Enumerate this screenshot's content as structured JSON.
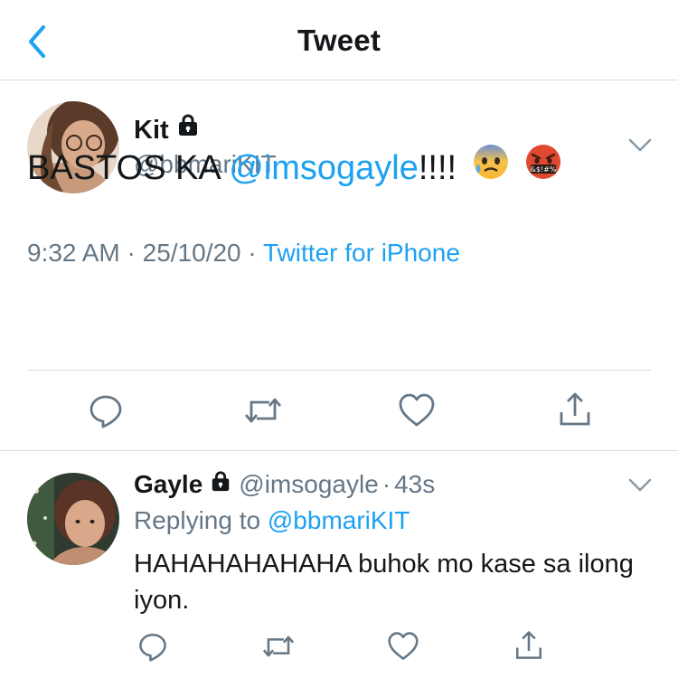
{
  "header": {
    "title": "Tweet"
  },
  "tweet": {
    "name": "Kit",
    "handle": "@bbmariKIT",
    "text_prefix": "BASTOS KA ",
    "mention": "@imsogayle",
    "text_suffix": "!!!!",
    "emojis": [
      "anxious-face-with-sweat",
      "face-with-symbols-on-mouth"
    ],
    "emoji_symbols": "&$!#%",
    "time": "9:32 AM",
    "date": "25/10/20",
    "source": "Twitter for iPhone",
    "sep": " · "
  },
  "reply": {
    "name": "Gayle",
    "handle": "@imsogayle",
    "age": "43s",
    "sep": "·",
    "replying_label": "Replying to ",
    "replying_to": "@bbmariKIT",
    "text": "HAHAHAHAHAHA buhok mo kase sa ilong iyon."
  },
  "colors": {
    "accent": "#1da1f2",
    "secondary": "#657786",
    "text": "#14171a",
    "divider": "#d6d9dc"
  },
  "icons": [
    "back-chevron-icon",
    "lock-icon",
    "chevron-down-icon",
    "reply-icon",
    "retweet-icon",
    "like-icon",
    "share-icon"
  ]
}
